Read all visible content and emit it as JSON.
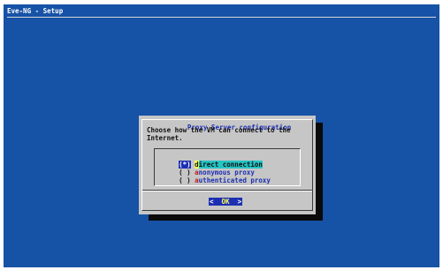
{
  "app": {
    "backtitle": "Eve-NG - Setup"
  },
  "dialog": {
    "title": "Proxy Server configuration",
    "prompt": "Choose how the VM can connect to the\nInternet.",
    "options": [
      {
        "mark": "(*)",
        "hotkey": "d",
        "rest": "irect connection",
        "selected": true
      },
      {
        "mark": "( )",
        "hotkey": "a",
        "rest": "nonymous proxy",
        "selected": false
      },
      {
        "mark": "( )",
        "hotkey": "a",
        "rest": "uthenticated proxy",
        "selected": false
      }
    ],
    "ok_left": "<",
    "ok_label": "OK",
    "ok_right": ">"
  },
  "colors": {
    "background": "#1652a6",
    "dialog": "#c6c6c6",
    "accent": "#1c2fb3",
    "hotkey": "#c41a1a",
    "highlight": "#25c4c4",
    "shadow": "#0a0a0a"
  }
}
